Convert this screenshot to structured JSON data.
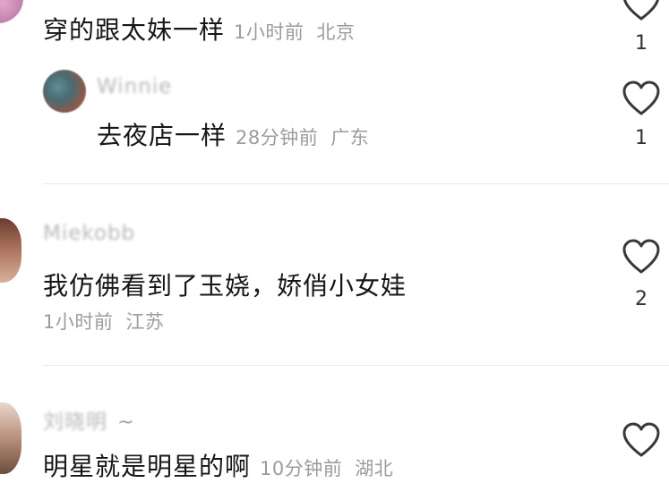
{
  "comments": [
    {
      "text": "穿的跟太妹一样",
      "time": "1小时前",
      "location": "北京",
      "likes": "1",
      "liked": false
    },
    {
      "author": "Winnie",
      "text": "去夜店一样",
      "time": "28分钟前",
      "location": "广东",
      "likes": "1",
      "liked": false
    },
    {
      "author": "Miekobb",
      "text": "我仿佛看到了玉娆，娇俏小女娃",
      "time": "1小时前",
      "location": "江苏",
      "likes": "2",
      "liked": false
    },
    {
      "author": "刘晓明",
      "author_suffix": "~",
      "text": "明星就是明星的啊",
      "time": "10分钟前",
      "location": "湖北"
    }
  ],
  "colors": {
    "text": "#161616",
    "meta": "#9c9c9c",
    "divider": "#e9e9e9",
    "heart_stroke": "#3a3a3a"
  },
  "icons": {
    "like": "heart-outline-icon"
  }
}
